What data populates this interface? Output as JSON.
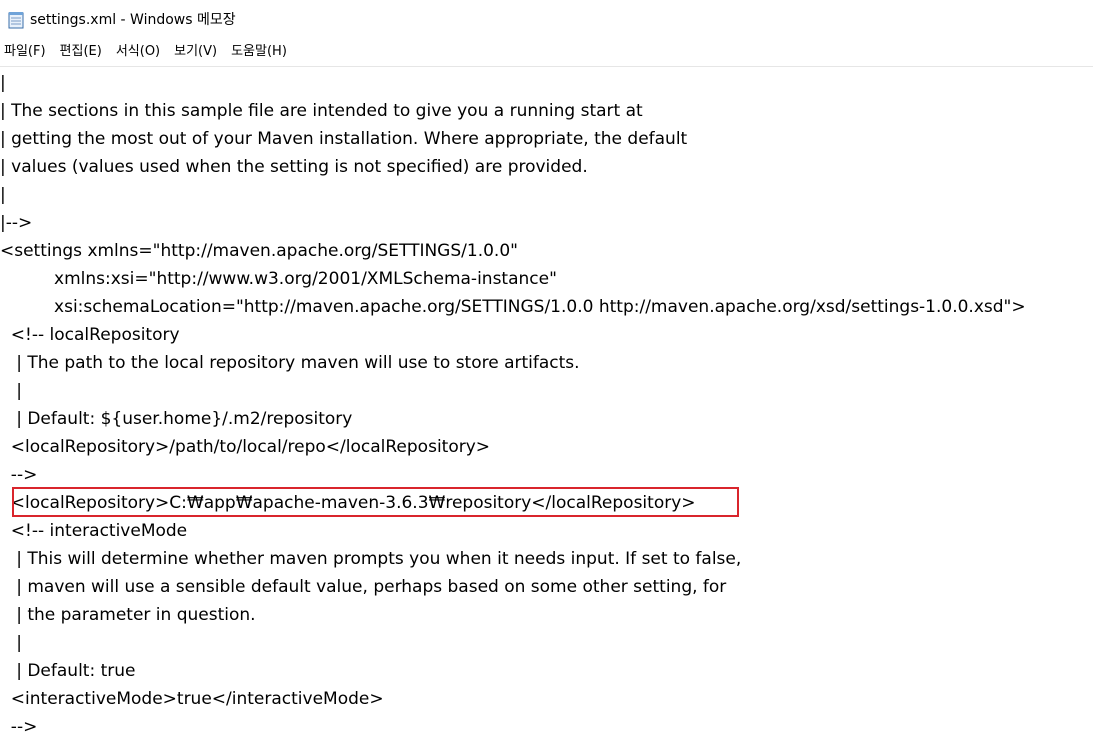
{
  "window": {
    "title": "settings.xml - Windows 메모장",
    "icon": "notepad-icon"
  },
  "menu": [
    {
      "label": "파일(F)",
      "name": "menu-file"
    },
    {
      "label": "편집(E)",
      "name": "menu-edit"
    },
    {
      "label": "서식(O)",
      "name": "menu-format"
    },
    {
      "label": "보기(V)",
      "name": "menu-view"
    },
    {
      "label": "도움말(H)",
      "name": "menu-help"
    }
  ],
  "editor": {
    "lines": [
      "|",
      "| The sections in this sample file are intended to give you a running start at",
      "| getting the most out of your Maven installation. Where appropriate, the default",
      "| values (values used when the setting is not specified) are provided.",
      "|",
      "|-->",
      "<settings xmlns=\"http://maven.apache.org/SETTINGS/1.0.0\"",
      "          xmlns:xsi=\"http://www.w3.org/2001/XMLSchema-instance\"",
      "          xsi:schemaLocation=\"http://maven.apache.org/SETTINGS/1.0.0 http://maven.apache.org/xsd/settings-1.0.0.xsd\">",
      "  <!-- localRepository",
      "   | The path to the local repository maven will use to store artifacts.",
      "   |",
      "   | Default: ${user.home}/.m2/repository",
      "  <localRepository>/path/to/local/repo</localRepository>",
      "  -->",
      "  <localRepository>C:₩app₩apache-maven-3.6.3₩repository</localRepository>",
      "  <!-- interactiveMode",
      "   | This will determine whether maven prompts you when it needs input. If set to false,",
      "   | maven will use a sensible default value, perhaps based on some other setting, for",
      "   | the parameter in question.",
      "   |",
      "   | Default: true",
      "  <interactiveMode>true</interactiveMode>",
      "  -->"
    ],
    "highlight_color": "#d9252c"
  }
}
